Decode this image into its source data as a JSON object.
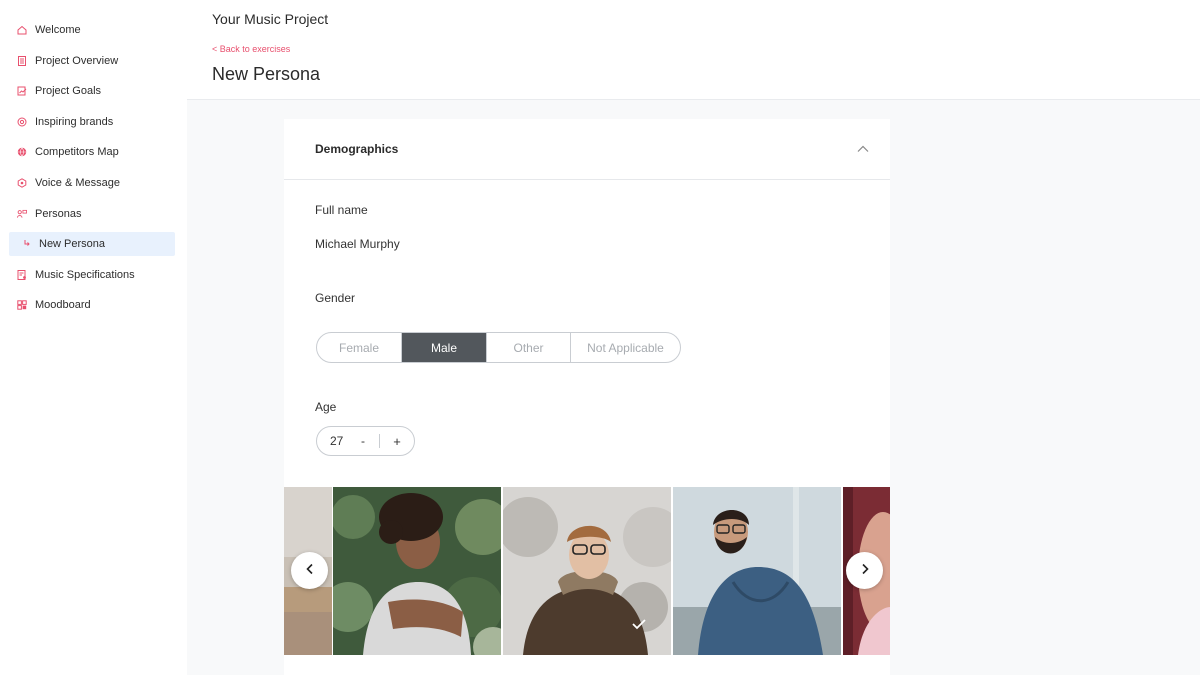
{
  "sidebar": {
    "items": [
      {
        "label": "Welcome",
        "icon": "home-icon"
      },
      {
        "label": "Project Overview",
        "icon": "document-icon"
      },
      {
        "label": "Project Goals",
        "icon": "goals-chart-icon"
      },
      {
        "label": "Inspiring brands",
        "icon": "target-icon"
      },
      {
        "label": "Competitors Map",
        "icon": "globe-icon"
      },
      {
        "label": "Voice & Message",
        "icon": "badge-icon"
      },
      {
        "label": "Personas",
        "icon": "personas-icon"
      },
      {
        "label": "New Persona",
        "icon": "sub-arrow-icon"
      },
      {
        "label": "Music Specifications",
        "icon": "music-doc-icon"
      },
      {
        "label": "Moodboard",
        "icon": "grid-icon"
      }
    ],
    "active": "New Persona"
  },
  "header": {
    "project_title": "Your Music Project",
    "back_link": "< Back to exercises",
    "page_title": "New Persona"
  },
  "card": {
    "section_title": "Demographics",
    "full_name_label": "Full name",
    "full_name_value": "Michael Murphy",
    "gender_label": "Gender",
    "gender_options": [
      "Female",
      "Male",
      "Other",
      "Not Applicable"
    ],
    "gender_selected": "Male",
    "age_label": "Age",
    "age_value": "27",
    "age_minus": "-",
    "age_plus": "+"
  },
  "colors": {
    "accent": "#e8506e",
    "selected_segment": "#52575c",
    "active_nav_bg": "#e8f1fd"
  }
}
